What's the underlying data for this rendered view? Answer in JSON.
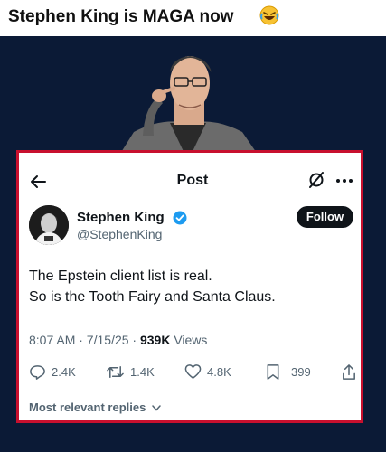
{
  "caption": {
    "text": "Stephen King is MAGA now",
    "emoji_icon": "rolling-on-floor-laughing-emoji"
  },
  "header": {
    "title": "Post"
  },
  "author": {
    "name": "Stephen King",
    "handle": "@StephenKing",
    "verified": true,
    "follow_label": "Follow"
  },
  "post": {
    "lines": [
      "The Epstein client list is real.",
      "So is the Tooth Fairy and Santa Claus."
    ],
    "time": "8:07 AM · 7/15/25 · ",
    "views_count": "939K",
    "views_label": " Views"
  },
  "actions": {
    "replies": "2.4K",
    "reposts": "1.4K",
    "likes": "4.8K",
    "bookmarks": "399"
  },
  "replies_sort": {
    "label": "Most relevant replies"
  },
  "colors": {
    "frame": "#c8102e",
    "background": "#0b1a36",
    "verified": "#1d9bf0",
    "text": "#0f1419",
    "muted": "#536471"
  }
}
